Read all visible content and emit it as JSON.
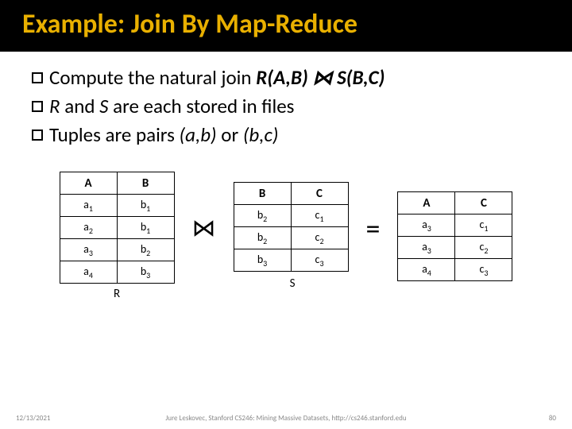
{
  "title": "Example: Join By Map-Reduce",
  "bullets": {
    "b1_prefix": "Compute the natural join ",
    "b1_rel": "R(A,B) ⋈ S(B,C)",
    "b2_R": "R",
    "b2_mid": " and ",
    "b2_S": "S",
    "b2_rest": " are each stored in files",
    "b3_prefix": "Tuples are pairs ",
    "b3_t1": "(a,b)",
    "b3_or": " or ",
    "b3_t2": "(b,c)"
  },
  "op_join": "⋈",
  "op_eq": "=",
  "tableR": {
    "label": "R",
    "headers": [
      "A",
      "B"
    ],
    "rows": [
      [
        "a|1",
        "b|1"
      ],
      [
        "a|2",
        "b|1"
      ],
      [
        "a|3",
        "b|2"
      ],
      [
        "a|4",
        "b|3"
      ]
    ]
  },
  "tableS": {
    "label": "S",
    "headers": [
      "B",
      "C"
    ],
    "rows": [
      [
        "b|2",
        "c|1"
      ],
      [
        "b|2",
        "c|2"
      ],
      [
        "b|3",
        "c|3"
      ]
    ]
  },
  "tableResult": {
    "headers": [
      "A",
      "C"
    ],
    "rows": [
      [
        "a|3",
        "c|1"
      ],
      [
        "a|3",
        "c|2"
      ],
      [
        "a|4",
        "c|3"
      ]
    ]
  },
  "footer": {
    "date": "12/13/2021",
    "credit": "Jure Leskovec, Stanford CS246: Mining Massive Datasets, http://cs246.stanford.edu",
    "page": "80"
  }
}
